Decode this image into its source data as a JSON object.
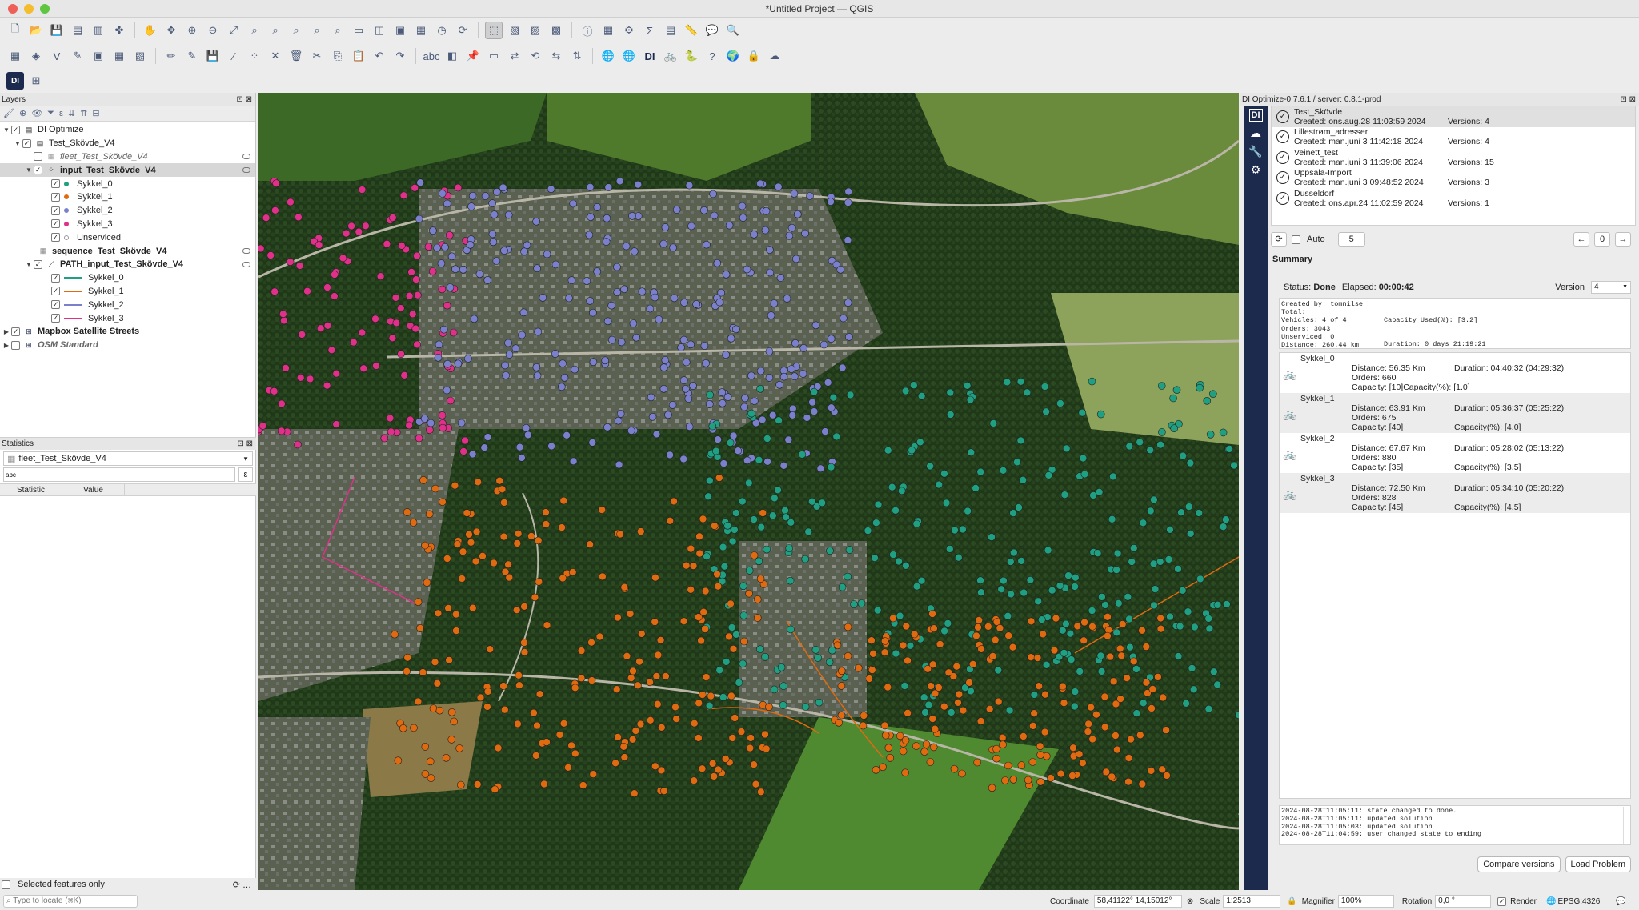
{
  "window": {
    "title": "*Untitled Project — QGIS"
  },
  "colors": {
    "sykkel_0": "#20a082",
    "sykkel_1": "#e06a10",
    "sykkel_2": "#7a80cc",
    "sykkel_3": "#e0308a",
    "plugin_sidebar": "#1c2a4e"
  },
  "layers_panel": {
    "title": "Layers",
    "items": [
      {
        "label": "DI Optimize",
        "bold": false,
        "kind": "group"
      },
      {
        "label": "Test_Skövde_V4",
        "kind": "group"
      },
      {
        "label": "fleet_Test_Skövde_V4",
        "kind": "layer-italic"
      },
      {
        "label": "input_Test_Skövde_V4",
        "kind": "layer-bold"
      },
      {
        "label": "Sykkel_0",
        "kind": "point",
        "color": "#20a082"
      },
      {
        "label": "Sykkel_1",
        "kind": "point",
        "color": "#e06a10"
      },
      {
        "label": "Sykkel_2",
        "kind": "point",
        "color": "#7a80cc"
      },
      {
        "label": "Sykkel_3",
        "kind": "point",
        "color": "#e0308a"
      },
      {
        "label": "Unserviced",
        "kind": "point-empty"
      },
      {
        "label": "sequence_Test_Skövde_V4",
        "kind": "table"
      },
      {
        "label": "PATH_input_Test_Skövde_V4",
        "kind": "group-line"
      },
      {
        "label": "Sykkel_0",
        "kind": "line",
        "color": "#20a082"
      },
      {
        "label": "Sykkel_1",
        "kind": "line",
        "color": "#e06a10"
      },
      {
        "label": "Sykkel_2",
        "kind": "line",
        "color": "#7a80cc"
      },
      {
        "label": "Sykkel_3",
        "kind": "line",
        "color": "#e0308a"
      },
      {
        "label": "Mapbox Satellite Streets",
        "kind": "xyz-bold"
      },
      {
        "label": "OSM Standard",
        "kind": "xyz-italic"
      }
    ]
  },
  "statistics_panel": {
    "title": "Statistics",
    "layer": "fleet_Test_Skövde_V4",
    "field": "abc",
    "columns": [
      "Statistic",
      "Value"
    ],
    "selected_only": "Selected features only"
  },
  "locator": {
    "placeholder": "Type to locate (⌘K)"
  },
  "plugin": {
    "title": "DI Optimize-0.7.6.1 / server: 0.8.1-prod",
    "projects": [
      {
        "name": "Test_Skövde",
        "created": "Created: ons.aug.28 11:03:59 2024",
        "versions": "Versions: 4"
      },
      {
        "name": "Lillestrøm_adresser",
        "created": "Created: man.juni 3 11:42:18 2024",
        "versions": "Versions: 4"
      },
      {
        "name": "Veinett_test",
        "created": "Created: man.juni 3 11:39:06 2024",
        "versions": "Versions: 15"
      },
      {
        "name": "Uppsala-Import",
        "created": "Created: man.juni 3 09:48:52 2024",
        "versions": "Versions: 3"
      },
      {
        "name": "Dusseldorf",
        "created": "Created: ons.apr.24 11:02:59 2024",
        "versions": "Versions: 1"
      }
    ],
    "auto_label": "Auto",
    "auto_value": "5",
    "page_value": "0",
    "summary_title": "Summary",
    "status_label": "Status:",
    "status_value": "Done",
    "elapsed_label": "Elapsed:",
    "elapsed_value": "00:00:42",
    "version_label": "Version",
    "version_value": "4",
    "totals": {
      "created_by": "Created by: tomnilse",
      "total": "Total:",
      "vehicles": "Vehicles: 4 of 4",
      "orders": "Orders: 3043",
      "unserviced": "Unserviced: 0",
      "distance": "Distance: 260.44 km",
      "capacity_used": "Capacity Used(%): [3.2]",
      "duration": "Duration: 0 days 21:19:21"
    },
    "vehicles": [
      {
        "name": "Sykkel_0",
        "distance": "Distance: 56.35 Km",
        "orders": "Orders: 660",
        "capacity": "Capacity: [10]",
        "duration": "Duration: 04:40:32 (04:29:32)",
        "capacity_pct": "Capacity(%): [1.0]"
      },
      {
        "name": "Sykkel_1",
        "distance": "Distance: 63.91 Km",
        "orders": "Orders: 675",
        "capacity": "Capacity: [40]",
        "duration": "Duration: 05:36:37 (05:25:22)",
        "capacity_pct": "Capacity(%): [4.0]"
      },
      {
        "name": "Sykkel_2",
        "distance": "Distance: 67.67 Km",
        "orders": "Orders: 880",
        "capacity": "Capacity: [35]",
        "duration": "Duration: 05:28:02 (05:13:22)",
        "capacity_pct": "Capacity(%): [3.5]"
      },
      {
        "name": "Sykkel_3",
        "distance": "Distance: 72.50 Km",
        "orders": "Orders: 828",
        "capacity": "Capacity: [45]",
        "duration": "Duration: 05:34:10 (05:20:22)",
        "capacity_pct": "Capacity(%): [4.5]"
      }
    ],
    "log": [
      "2024-08-28T11:05:11: state changed to done.",
      "2024-08-28T11:05:11: updated solution",
      "2024-08-28T11:05:03: updated solution",
      "2024-08-28T11:04:59: user changed state to ending"
    ],
    "compare_button": "Compare versions",
    "load_button": "Load Problem"
  },
  "statusbar": {
    "coordinate_label": "Coordinate",
    "coordinate_value": "58,41122° 14,15012°",
    "scale_label": "Scale",
    "scale_value": "1:2513",
    "magnifier_label": "Magnifier",
    "magnifier_value": "100%",
    "rotation_label": "Rotation",
    "rotation_value": "0,0 °",
    "render_label": "Render",
    "crs": "EPSG:4326"
  }
}
